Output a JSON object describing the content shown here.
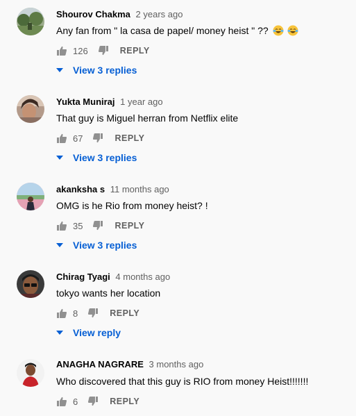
{
  "comments": [
    {
      "author": "Shourov Chakma",
      "time": "2 years ago",
      "text": "Any fan from \" la casa de papel/ money heist \" ??",
      "emoji": "tears-of-joy-emoji",
      "likes": "126",
      "reply_label": "REPLY",
      "view_replies": "View 3 replies",
      "avatar": "landscape-photo"
    },
    {
      "author": "Yukta Muniraj",
      "time": "1 year ago",
      "text": "That guy is Miguel herran from Netflix elite",
      "likes": "67",
      "reply_label": "REPLY",
      "view_replies": "View 3 replies",
      "avatar": "portrait-photo"
    },
    {
      "author": "akanksha s",
      "time": "11 months ago",
      "text": "OMG is he Rio from money heist? !",
      "likes": "35",
      "reply_label": "REPLY",
      "view_replies": "View 3 replies",
      "avatar": "portrait-photo"
    },
    {
      "author": "Chirag Tyagi",
      "time": "4 months ago",
      "text": "tokyo wants her location",
      "likes": "8",
      "reply_label": "REPLY",
      "view_replies": "View reply",
      "avatar": "portrait-photo"
    },
    {
      "author": "ANAGHA NAGRARE",
      "time": "3 months ago",
      "text": "Who discovered that this guy is RIO from money Heist!!!!!!!",
      "likes": "6",
      "reply_label": "REPLY",
      "avatar": "portrait-photo"
    }
  ],
  "colors": {
    "background": "#f9f9f9",
    "link": "#065fd4",
    "secondary_text": "#606060",
    "primary_text": "#030303"
  }
}
